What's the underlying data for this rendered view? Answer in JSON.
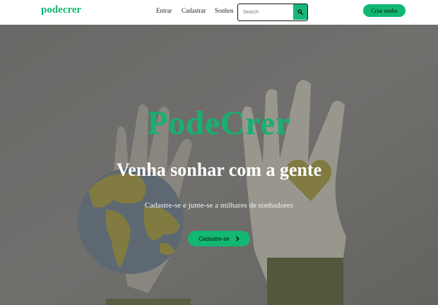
{
  "navbar": {
    "brand": "podecrer",
    "links": [
      "Entrar",
      "Cadastrar",
      "Sonhos"
    ],
    "search": {
      "placeholder": "Search",
      "icon": "search-icon"
    },
    "cta_label": "Criar sonho"
  },
  "hero": {
    "title": "PodeCrer",
    "subtitle": "Venha sonhar com a gente",
    "text": "Cadastre-se e junte-se a milhares de sonhadores",
    "button_label": "Cadastre-se",
    "button_icon": "chevron-right-icon"
  },
  "colors": {
    "brand": "#12b772",
    "overlay": "#5e5e5e",
    "globe_ocean": "#5c6d7f",
    "globe_land": "#948a33",
    "heart": "#948a33",
    "sleeve": "#4a5529",
    "hand": "#b7b4a6"
  }
}
